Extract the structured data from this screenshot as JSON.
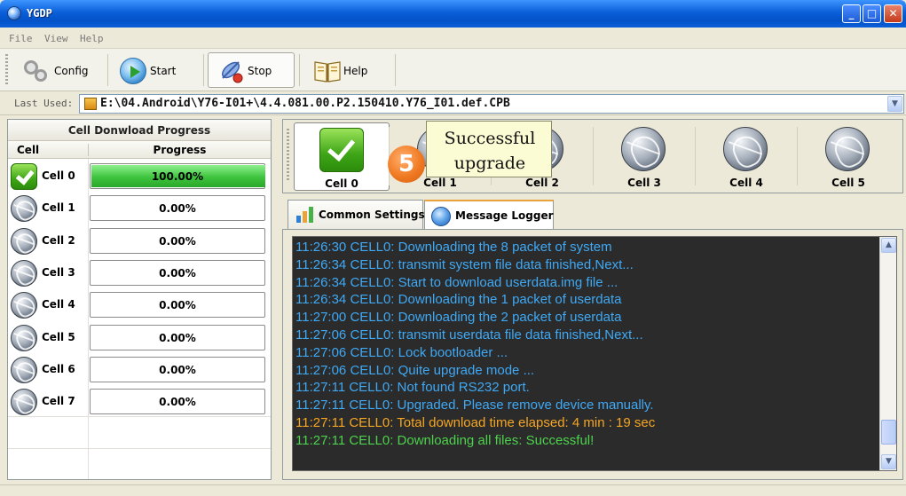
{
  "window": {
    "title": "YGDP"
  },
  "menu": [
    "File",
    "View",
    "Help"
  ],
  "toolbar": {
    "config_label": "Config",
    "start_label": "Start",
    "stop_label": "Stop",
    "help_label": "Help"
  },
  "last_used": {
    "label": "Last Used:",
    "value": "E:\\04.Android\\Y76-I01+\\4.4.081.00.P2.150410.Y76_I01.def.CPB"
  },
  "left_panel": {
    "title": "Cell Donwload Progress",
    "col_cell": "Cell",
    "col_progress": "Progress",
    "rows": [
      {
        "name": "Cell 0",
        "progress": "100.00%",
        "fraction": 1.0,
        "icon": "check-icon"
      },
      {
        "name": "Cell 1",
        "progress": "0.00%",
        "fraction": 0,
        "icon": "globe-icon"
      },
      {
        "name": "Cell 2",
        "progress": "0.00%",
        "fraction": 0,
        "icon": "globe-icon"
      },
      {
        "name": "Cell 3",
        "progress": "0.00%",
        "fraction": 0,
        "icon": "globe-icon"
      },
      {
        "name": "Cell 4",
        "progress": "0.00%",
        "fraction": 0,
        "icon": "globe-icon"
      },
      {
        "name": "Cell 5",
        "progress": "0.00%",
        "fraction": 0,
        "icon": "globe-icon"
      },
      {
        "name": "Cell 6",
        "progress": "0.00%",
        "fraction": 0,
        "icon": "globe-icon"
      },
      {
        "name": "Cell 7",
        "progress": "0.00%",
        "fraction": 0,
        "icon": "globe-icon"
      }
    ]
  },
  "cell_strip": [
    {
      "label": "Cell 0",
      "icon": "check-icon",
      "active": true
    },
    {
      "label": "Cell 1",
      "icon": "globe-icon"
    },
    {
      "label": "Cell 2",
      "icon": "globe-icon"
    },
    {
      "label": "Cell 3",
      "icon": "globe-icon"
    },
    {
      "label": "Cell 4",
      "icon": "globe-icon"
    },
    {
      "label": "Cell 5",
      "icon": "globe-icon"
    }
  ],
  "callout": {
    "number": "5",
    "line1": "Successful",
    "line2": "upgrade"
  },
  "tabs": [
    {
      "label": "Common Settings",
      "icon": "bar-chart-icon"
    },
    {
      "label": "Message Logger",
      "icon": "globe-icon",
      "selected": true
    }
  ],
  "log": [
    {
      "text": "11:26:30  CELL0: Downloading the 8 packet of system",
      "color": "#3fa9f5"
    },
    {
      "text": "11:26:34  CELL0: transmit system file data  finished,Next...",
      "color": "#3fa9f5"
    },
    {
      "text": "11:26:34  CELL0:  Start to download userdata.img file ...",
      "color": "#3fa9f5"
    },
    {
      "text": "11:26:34  CELL0: Downloading the 1 packet of userdata",
      "color": "#3fa9f5"
    },
    {
      "text": "11:27:00  CELL0: Downloading the 2 packet of userdata",
      "color": "#3fa9f5"
    },
    {
      "text": "11:27:06  CELL0: transmit userdata file data  finished,Next...",
      "color": "#3fa9f5"
    },
    {
      "text": "11:27:06  CELL0: Lock bootloader ...",
      "color": "#3fa9f5"
    },
    {
      "text": "11:27:06  CELL0: Quite upgrade mode ...",
      "color": "#3fa9f5"
    },
    {
      "text": "11:27:11  CELL0: Not found RS232 port.",
      "color": "#3fa9f5"
    },
    {
      "text": "11:27:11  CELL0: Upgraded. Please remove device manually.",
      "color": "#3fa9f5"
    },
    {
      "text": "11:27:11  CELL0: Total download time elapsed: 4 min : 19 sec",
      "color": "#f5a623"
    },
    {
      "text": "11:27:11  CELL0: Downloading all files: Successful!",
      "color": "#4cd24c"
    }
  ]
}
